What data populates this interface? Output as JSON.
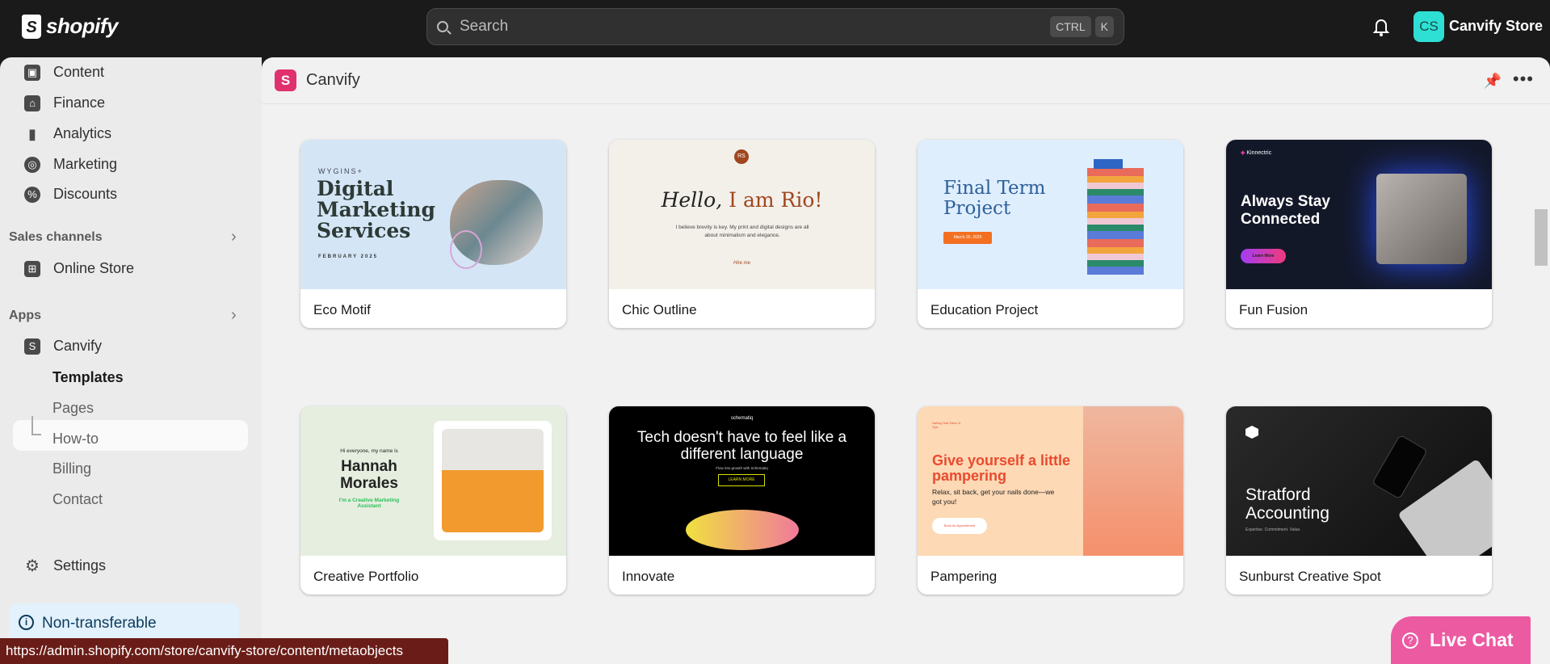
{
  "topbar": {
    "brand": "shopify",
    "search_placeholder": "Search",
    "shortcut": [
      "CTRL",
      "K"
    ],
    "avatar_initials": "CS",
    "store_name": "Canvify Store"
  },
  "sidebar": {
    "items": [
      {
        "label": "Content",
        "icon": "content-icon"
      },
      {
        "label": "Finance",
        "icon": "bank-icon"
      },
      {
        "label": "Analytics",
        "icon": "bar-chart-icon"
      },
      {
        "label": "Marketing",
        "icon": "target-icon"
      },
      {
        "label": "Discounts",
        "icon": "discount-icon"
      }
    ],
    "sales_channels": {
      "title": "Sales channels",
      "items": [
        {
          "label": "Online Store",
          "icon": "store-icon"
        }
      ]
    },
    "apps": {
      "title": "Apps",
      "app": "Canvify",
      "subitems": [
        "Templates",
        "Pages",
        "How-to",
        "Billing",
        "Contact"
      ],
      "active": "Templates"
    },
    "settings": "Settings",
    "notice": "Non-transferable"
  },
  "main": {
    "app_title": "Canvify",
    "templates": [
      {
        "name": "Eco Motif",
        "preview": {
          "brand": "WYGINS+",
          "title": "Digital Marketing Services",
          "date": "FEBRUARY 2025"
        },
        "bg": "#d4e6f6"
      },
      {
        "name": "Chic Outline",
        "preview": {
          "monogram": "RS",
          "title_a": "Hello,",
          "title_b": "I am Rio!",
          "body": "I believe brevity is key. My print and digital designs are all about minimalism and elegance.",
          "link": "Hire me"
        },
        "bg": "#f3f0ea"
      },
      {
        "name": "Education Project",
        "preview": {
          "title": "Final Term Project",
          "button": "March 25, 2025"
        },
        "bg": "#dfeefd"
      },
      {
        "name": "Fun Fusion",
        "preview": {
          "brand": "Kinnectric",
          "title": "Always Stay Connected",
          "button": "Learn More"
        },
        "bg": "#131829"
      },
      {
        "name": "Creative Portfolio",
        "preview": {
          "intro": "Hi everyone, my name is",
          "title": "Hannah Morales",
          "subtitle": "I'm a Creative Marketing Assistant"
        },
        "bg": "#e5eedf"
      },
      {
        "name": "Innovate",
        "preview": {
          "brand": "schematiq",
          "title": "Tech doesn't have to feel like a different language",
          "body": "Flow into growth with Schematiq",
          "button": "LEARN MORE"
        },
        "bg": "#000000"
      },
      {
        "name": "Pampering",
        "preview": {
          "brand": "Nailing Nail Salon & Spa",
          "title": "Give yourself a little pampering",
          "body": "Relax, sit back, get your nails done—we got you!",
          "button": "Book An Appointment"
        },
        "bg": "#fdd9b5"
      },
      {
        "name": "Sunburst Creative Spot",
        "preview": {
          "title": "Stratford Accounting",
          "body": "Expertise. Commitment. Value."
        },
        "bg": "#161616"
      }
    ]
  },
  "status_url": "https://admin.shopify.com/store/canvify-store/content/metaobjects",
  "live_chat": "Live Chat",
  "colors": {
    "accent": "#e0306e",
    "live_chat": "#ec5aa2",
    "avatar": "#2ee0d4"
  }
}
